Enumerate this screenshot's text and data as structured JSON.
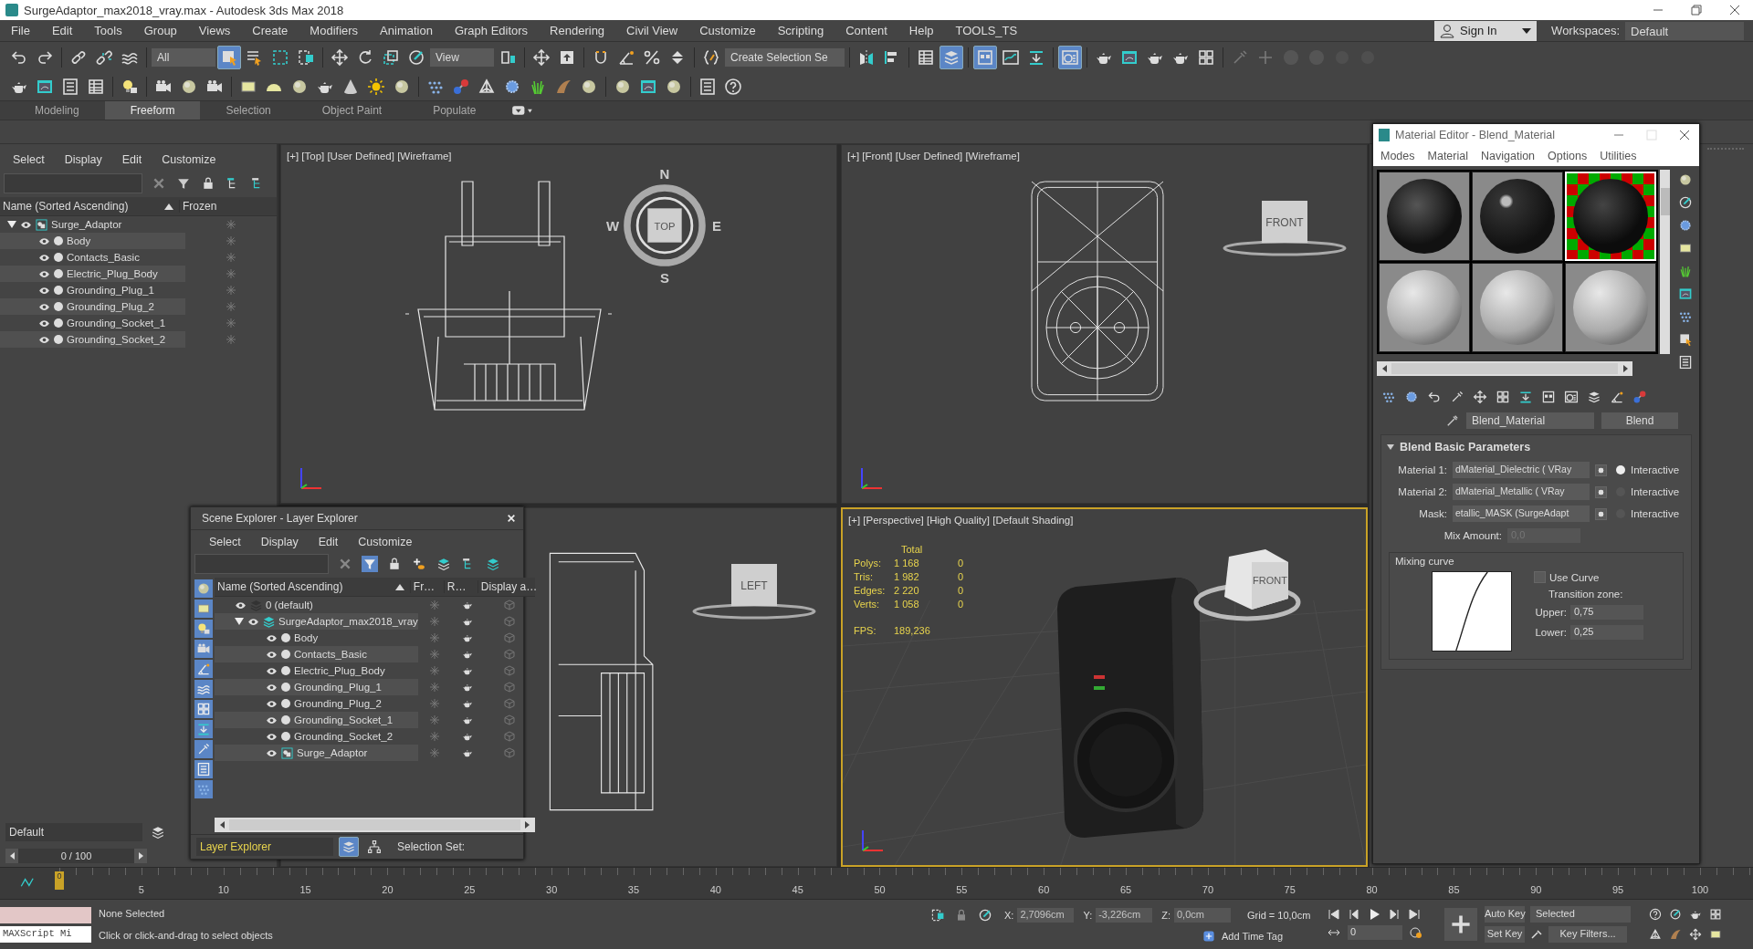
{
  "window": {
    "title": "SurgeAdaptor_max2018_vray.max - Autodesk 3ds Max 2018"
  },
  "menu": [
    "File",
    "Edit",
    "Tools",
    "Group",
    "Views",
    "Create",
    "Modifiers",
    "Animation",
    "Graph Editors",
    "Rendering",
    "Civil View",
    "Customize",
    "Scripting",
    "Content",
    "Help",
    "TOOLS_TS"
  ],
  "account": {
    "sign_in": "Sign In",
    "workspaces_label": "Workspaces:",
    "workspace": "Default"
  },
  "main_toolbar": [
    {
      "kind": "undo",
      "selected": false
    },
    {
      "kind": "redo",
      "selected": false
    },
    {
      "kind": "separator"
    },
    {
      "kind": "link",
      "selected": false
    },
    {
      "kind": "unlink",
      "selected": false
    },
    {
      "kind": "bind",
      "selected": false
    },
    {
      "kind": "separator"
    },
    {
      "kind": "dropdown",
      "value": "All"
    },
    {
      "kind": "select",
      "selected": true
    },
    {
      "kind": "select-name",
      "selected": false
    },
    {
      "kind": "region",
      "selected": false
    },
    {
      "kind": "crossing",
      "selected": false
    },
    {
      "kind": "separator"
    },
    {
      "kind": "move",
      "selected": false
    },
    {
      "kind": "rotate",
      "selected": false
    },
    {
      "kind": "scale",
      "selected": false
    },
    {
      "kind": "place",
      "selected": false
    },
    {
      "kind": "dropdown",
      "value": "View"
    },
    {
      "kind": "pivot",
      "selected": false
    },
    {
      "kind": "separator"
    },
    {
      "kind": "move",
      "selected": false
    },
    {
      "kind": "upload",
      "selected": false
    },
    {
      "kind": "separator"
    },
    {
      "kind": "snap",
      "selected": false
    },
    {
      "kind": "angle",
      "selected": false
    },
    {
      "kind": "percent",
      "selected": false
    },
    {
      "kind": "spinner",
      "selected": false
    },
    {
      "kind": "separator"
    },
    {
      "kind": "braces",
      "selected": false
    },
    {
      "kind": "dropdown",
      "value": "Create Selection Se"
    },
    {
      "kind": "separator"
    },
    {
      "kind": "mirror",
      "selected": false
    },
    {
      "kind": "align",
      "selected": false
    },
    {
      "kind": "separator"
    },
    {
      "kind": "table",
      "selected": false
    },
    {
      "kind": "layers",
      "selected": true
    },
    {
      "kind": "separator"
    },
    {
      "kind": "ribbon",
      "selected": true
    },
    {
      "kind": "curve",
      "selected": false
    },
    {
      "kind": "download",
      "selected": false
    },
    {
      "kind": "separator"
    },
    {
      "kind": "material",
      "selected": true
    },
    {
      "kind": "separator"
    },
    {
      "kind": "teapot",
      "selected": false
    },
    {
      "kind": "frame",
      "selected": false
    },
    {
      "kind": "teapot",
      "selected": false
    },
    {
      "kind": "teapot",
      "selected": false
    },
    {
      "kind": "grid",
      "selected": false
    }
  ],
  "dimmed_tools": [
    {
      "kind": "brush"
    },
    {
      "kind": "plus"
    },
    {
      "kind": "dot"
    },
    {
      "kind": "dot"
    },
    {
      "kind": "glow"
    },
    {
      "kind": "glow"
    }
  ],
  "object_toolbar": [
    {
      "kind": "teapot",
      "selected": false
    },
    {
      "kind": "frame",
      "selected": false
    },
    {
      "kind": "list",
      "selected": false
    },
    {
      "kind": "table",
      "selected": false
    },
    {
      "kind": "separator"
    },
    {
      "kind": "bulb",
      "selected": false
    },
    {
      "kind": "separator"
    },
    {
      "kind": "camera",
      "selected": false
    },
    {
      "kind": "sphere",
      "selected": false
    },
    {
      "kind": "camera",
      "selected": false
    },
    {
      "kind": "separator"
    },
    {
      "kind": "box",
      "selected": false
    },
    {
      "kind": "dome",
      "selected": false
    },
    {
      "kind": "sphere",
      "selected": false
    },
    {
      "kind": "teapot",
      "selected": false
    },
    {
      "kind": "cone",
      "selected": false
    },
    {
      "kind": "sun",
      "selected": false
    },
    {
      "kind": "sphere",
      "selected": false
    },
    {
      "kind": "separator"
    },
    {
      "kind": "dots",
      "selected": false
    },
    {
      "kind": "molecule",
      "selected": false
    },
    {
      "kind": "pyramid",
      "selected": false
    },
    {
      "kind": "spiky",
      "selected": false
    },
    {
      "kind": "grass",
      "selected": false
    },
    {
      "kind": "hair",
      "selected": false
    },
    {
      "kind": "sphere",
      "selected": false
    },
    {
      "kind": "separator"
    },
    {
      "kind": "sphere",
      "selected": false
    },
    {
      "kind": "frame",
      "selected": false
    },
    {
      "kind": "sphere",
      "selected": false
    },
    {
      "kind": "separator"
    },
    {
      "kind": "list",
      "selected": false
    },
    {
      "kind": "help",
      "selected": false
    }
  ],
  "ribbon_tabs": [
    {
      "label": "Modeling",
      "selected": false
    },
    {
      "label": "Freeform",
      "selected": true
    },
    {
      "label": "Selection",
      "selected": false
    },
    {
      "label": "Object Paint",
      "selected": false
    },
    {
      "label": "Populate",
      "selected": false
    }
  ],
  "scene_explorer": {
    "menu": [
      "Select",
      "Display",
      "Edit",
      "Customize"
    ],
    "columns": [
      "Name (Sorted Ascending)",
      "Frozen"
    ],
    "tree": [
      {
        "name": "Surge_Adaptor",
        "kind": "group",
        "expanded": true,
        "children": [
          {
            "name": "Body",
            "kind": "object"
          },
          {
            "name": "Contacts_Basic",
            "kind": "object"
          },
          {
            "name": "Electric_Plug_Body",
            "kind": "object"
          },
          {
            "name": "Grounding_Plug_1",
            "kind": "object"
          },
          {
            "name": "Grounding_Plug_2",
            "kind": "object"
          },
          {
            "name": "Grounding_Socket_1",
            "kind": "object"
          },
          {
            "name": "Grounding_Socket_2",
            "kind": "object"
          }
        ]
      }
    ]
  },
  "left_bottom": {
    "layer": "Default",
    "time": "0 / 100"
  },
  "viewports": [
    {
      "kind": "top",
      "label": "[+] [Top] [User Defined] [Wireframe]",
      "cube": "TOP",
      "compass": [
        "N",
        "E",
        "S",
        "W"
      ],
      "active": false
    },
    {
      "kind": "front",
      "label": "[+] [Front] [User Defined] [Wireframe]",
      "cube": "FRONT",
      "active": false
    },
    {
      "kind": "left",
      "cube": "LEFT",
      "active": false
    },
    {
      "kind": "perspective",
      "label": "[+] [Perspective] [High Quality] [Default Shading]",
      "cube": "FRONT",
      "active": true,
      "stats": {
        "header": "Total",
        "rows": [
          {
            "label": "Polys:",
            "total": "1 168",
            "selection": "0"
          },
          {
            "label": "Tris:",
            "total": "1 982",
            "selection": "0"
          },
          {
            "label": "Edges:",
            "total": "2 220",
            "selection": "0"
          },
          {
            "label": "Verts:",
            "total": "1 058",
            "selection": "0"
          }
        ],
        "fps_label": "FPS:",
        "fps": "189,236"
      }
    }
  ],
  "layer_explorer": {
    "title": "Scene Explorer - Layer Explorer",
    "menu": [
      "Select",
      "Display",
      "Edit",
      "Customize"
    ],
    "columns": [
      "Name (Sorted Ascending)",
      "Fr…",
      "R…",
      "Display a…"
    ],
    "tree": [
      {
        "name": "0 (default)",
        "kind": "layer"
      },
      {
        "name": "SurgeAdaptor_max2018_vray",
        "kind": "active-layer",
        "expanded": true,
        "children": [
          {
            "name": "Body",
            "kind": "object"
          },
          {
            "name": "Contacts_Basic",
            "kind": "object"
          },
          {
            "name": "Electric_Plug_Body",
            "kind": "object"
          },
          {
            "name": "Grounding_Plug_1",
            "kind": "object"
          },
          {
            "name": "Grounding_Plug_2",
            "kind": "object"
          },
          {
            "name": "Grounding_Socket_1",
            "kind": "object"
          },
          {
            "name": "Grounding_Socket_2",
            "kind": "object"
          },
          {
            "name": "Surge_Adaptor",
            "kind": "group"
          }
        ]
      }
    ],
    "mode": "Layer Explorer",
    "selection_set": "Selection Set:"
  },
  "material_editor": {
    "title": "Material Editor - Blend_Material",
    "menu": [
      "Modes",
      "Material",
      "Navigation",
      "Options",
      "Utilities"
    ],
    "slots": [
      {
        "kind": "dark",
        "selected": false
      },
      {
        "kind": "dark-glossy",
        "selected": false
      },
      {
        "kind": "dark-checker",
        "selected": true
      },
      {
        "kind": "grey",
        "selected": false
      },
      {
        "kind": "grey",
        "selected": false
      },
      {
        "kind": "grey",
        "selected": false
      }
    ],
    "material_name": "Blend_Material",
    "material_type": "Blend",
    "rollout": "Blend Basic Parameters",
    "params": [
      {
        "label": "Material 1:",
        "value": "dMaterial_Dielectric  ( VRay",
        "checked": true,
        "interactive": true,
        "option": "Interactive"
      },
      {
        "label": "Material 2:",
        "value": "dMaterial_Metallic  ( VRay",
        "checked": true,
        "interactive": false,
        "option": "Interactive"
      },
      {
        "label": "Mask:",
        "value": "etallic_MASK (SurgeAdapt",
        "checked": true,
        "interactive": false,
        "option": "Interactive"
      }
    ],
    "mix_label": "Mix Amount:",
    "mix_value": "0,0",
    "curve": {
      "title": "Mixing curve",
      "use_curve": "Use Curve",
      "use_curve_checked": false,
      "zone": "Transition zone:",
      "upper_label": "Upper:",
      "upper": "0,75",
      "lower_label": "Lower:",
      "lower": "0,25"
    }
  },
  "timeline": {
    "frame": "0",
    "labels": [
      "5",
      "10",
      "15",
      "20",
      "25",
      "30",
      "35",
      "40",
      "45",
      "50",
      "55",
      "60",
      "65",
      "70",
      "75",
      "80",
      "85",
      "90",
      "95",
      "100"
    ]
  },
  "status": {
    "script": "MAXScript Mi",
    "selection": "None Selected",
    "prompt": "Click or click-and-drag to select objects",
    "coords": [
      {
        "label": "X:",
        "value": "2,7096cm"
      },
      {
        "label": "Y:",
        "value": "-3,226cm"
      },
      {
        "label": "Z:",
        "value": "0,0cm"
      }
    ],
    "grid": "Grid = 10,0cm",
    "time_tag": "Add Time Tag",
    "frame": "0",
    "auto_key": "Auto Key",
    "key_mode": "Selected",
    "set_key": "Set Key",
    "key_filters": "Key Filters..."
  }
}
